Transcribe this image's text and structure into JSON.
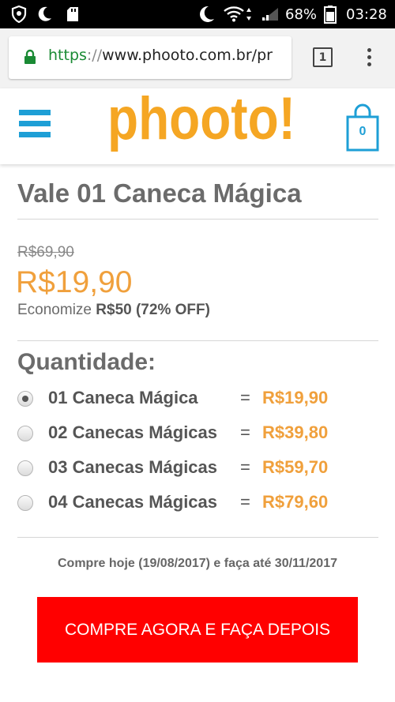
{
  "status_bar": {
    "battery": "68%",
    "time": "03:28"
  },
  "browser": {
    "url_scheme": "https",
    "url_separator": "://",
    "url_host": "www.phooto.com.br/pr",
    "tab_count": "1"
  },
  "header": {
    "logo_text": "phooto!",
    "cart_count": "0",
    "colors": {
      "accent_blue": "#1e9fd6",
      "logo_orange": "#f5a623"
    }
  },
  "product": {
    "title": "Vale 01 Caneca Mágica",
    "old_price": "R$69,90",
    "new_price": "R$19,90",
    "economize_prefix": "Economize ",
    "economize_value": "R$50 (72% OFF)"
  },
  "quantity": {
    "label": "Quantidade:",
    "equals": "=",
    "options": [
      {
        "label": "01 Caneca Mágica",
        "price": "R$19,90",
        "selected": true
      },
      {
        "label": "02 Canecas Mágicas",
        "price": "R$39,80",
        "selected": false
      },
      {
        "label": "03 Canecas Mágicas",
        "price": "R$59,70",
        "selected": false
      },
      {
        "label": "04 Canecas Mágicas",
        "price": "R$79,60",
        "selected": false
      }
    ]
  },
  "notice": "Compre hoje (19/08/2017) e faça até 30/11/2017",
  "cta": {
    "label": "COMPRE AGORA E FAÇA DEPOIS",
    "color": "#ff0000"
  }
}
